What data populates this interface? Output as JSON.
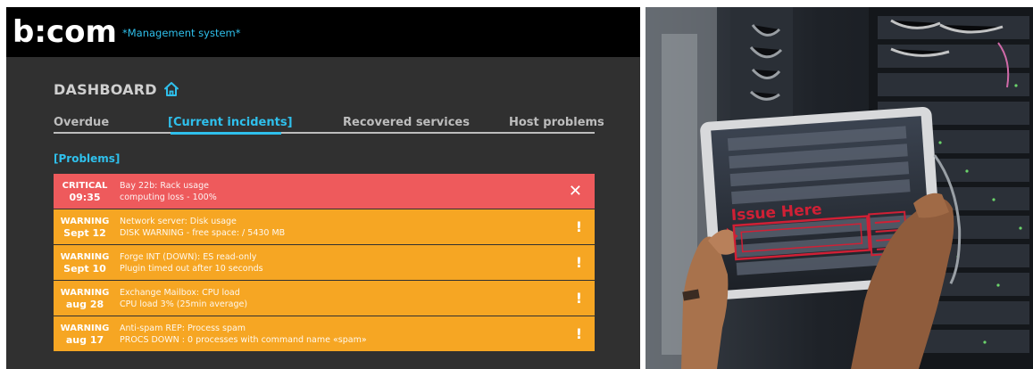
{
  "app": {
    "logo_text": "b:com",
    "subtitle": "*Management system*"
  },
  "dashboard": {
    "title": "DASHBOARD",
    "home_icon": "home-icon"
  },
  "tabs": [
    {
      "label": "Overdue",
      "active": false
    },
    {
      "label": "[Current incidents]",
      "active": true
    },
    {
      "label": "Recovered services",
      "active": false
    },
    {
      "label": "Host problems",
      "active": false
    }
  ],
  "section": {
    "label": "[Problems]"
  },
  "incidents": [
    {
      "level": "CRITICAL",
      "when": "09:35",
      "title": "Bay 22b: Rack usage",
      "detail": "computing loss - 100%",
      "action": "✕",
      "action_icon": "close-icon"
    },
    {
      "level": "WARNING",
      "when": "Sept 12",
      "title": "Network server: Disk usage",
      "detail": "DISK WARNING - free space: / 5430 MB",
      "action": "!",
      "action_icon": "alert-icon"
    },
    {
      "level": "WARNING",
      "when": "Sept 10",
      "title": "Forge INT (DOWN): ES read-only",
      "detail": "Plugin timed out after 10 seconds",
      "action": "!",
      "action_icon": "alert-icon"
    },
    {
      "level": "WARNING",
      "when": "aug 28",
      "title": "Exchange Mailbox: CPU load",
      "detail": "CPU load 3% (25min average)",
      "action": "!",
      "action_icon": "alert-icon"
    },
    {
      "level": "WARNING",
      "when": "aug 17",
      "title": "Anti-spam REP: Process spam",
      "detail": "PROCS DOWN : 0 processes with command name «spam»",
      "action": "!",
      "action_icon": "alert-icon"
    }
  ],
  "photo": {
    "ar_overlay_text": "Issue Here"
  },
  "colors": {
    "accent": "#2fc0ec",
    "critical": "#ee5a5c",
    "warning": "#f6a623",
    "panel_bg": "#303030",
    "topbar_bg": "#000000"
  }
}
